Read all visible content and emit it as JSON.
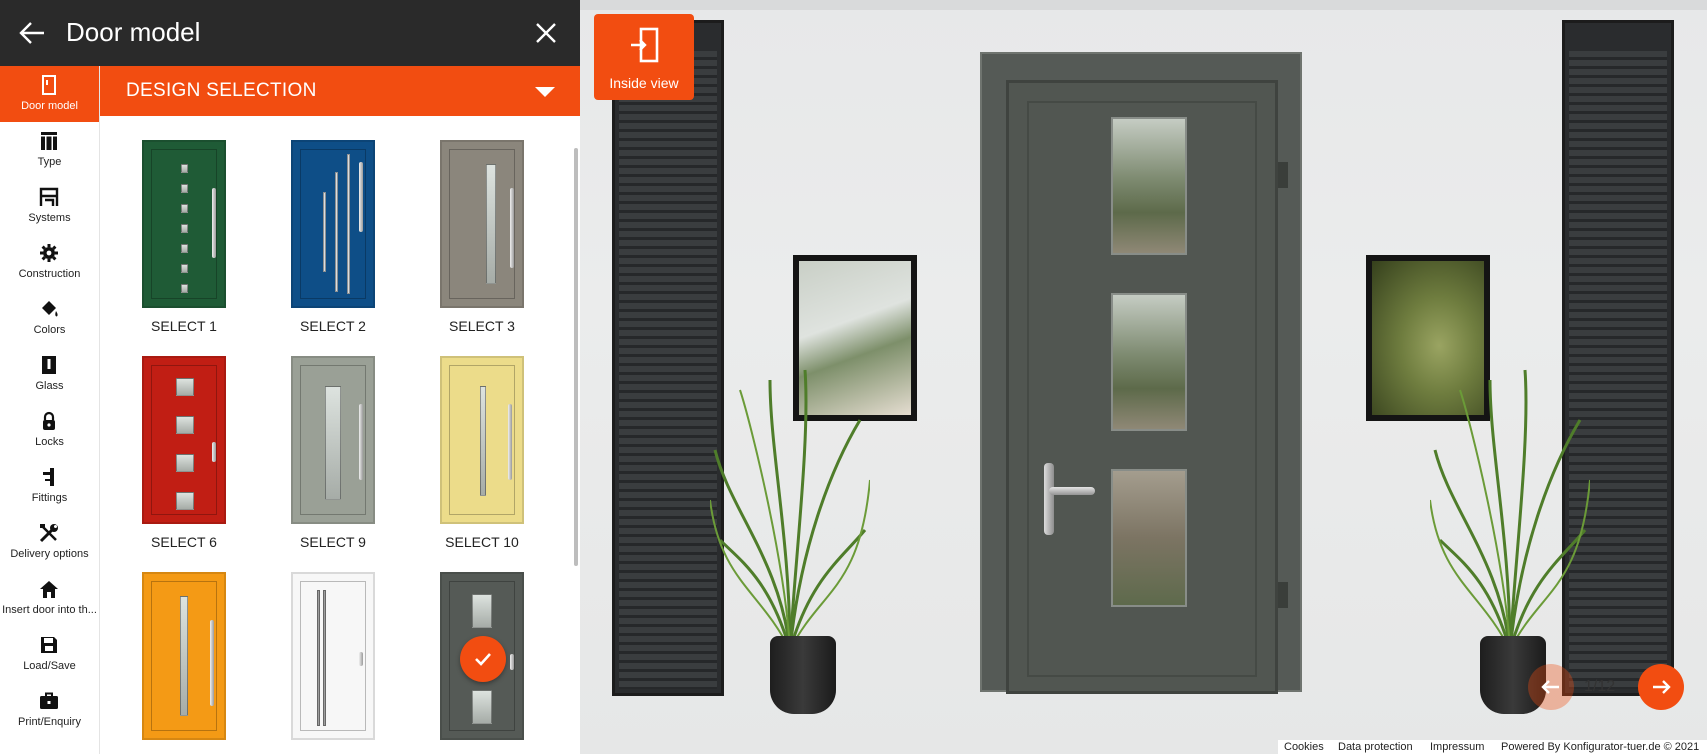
{
  "header": {
    "title": "Door model"
  },
  "nav": {
    "items": [
      {
        "label": "Door model",
        "icon": "door-model-icon"
      },
      {
        "label": "Type",
        "icon": "type-icon"
      },
      {
        "label": "Systems",
        "icon": "systems-icon"
      },
      {
        "label": "Construction",
        "icon": "gear-icon"
      },
      {
        "label": "Colors",
        "icon": "paint-bucket-icon"
      },
      {
        "label": "Glass",
        "icon": "glass-icon"
      },
      {
        "label": "Locks",
        "icon": "lock-icon"
      },
      {
        "label": "Fittings",
        "icon": "fittings-icon"
      },
      {
        "label": "Delivery options",
        "icon": "tools-icon"
      },
      {
        "label": "Insert door into th...",
        "icon": "home-icon"
      },
      {
        "label": "Load/Save",
        "icon": "floppy-disk-icon"
      },
      {
        "label": "Print/Enquiry",
        "icon": "briefcase-icon"
      }
    ]
  },
  "design": {
    "title": "DESIGN SELECTION",
    "doors": [
      {
        "label": "SELECT 1",
        "color": "#1f5b36"
      },
      {
        "label": "SELECT 2",
        "color": "#0e4e87"
      },
      {
        "label": "SELECT 3",
        "color": "#8b867c"
      },
      {
        "label": "SELECT 6",
        "color": "#c11e14"
      },
      {
        "label": "SELECT 9",
        "color": "#9aa096"
      },
      {
        "label": "SELECT 10",
        "color": "#ecdc8a"
      },
      {
        "label": "",
        "color": "#f49a15"
      },
      {
        "label": "",
        "color": "#f7f7f7"
      },
      {
        "label": "",
        "color": "#555a56"
      }
    ]
  },
  "scene": {
    "inside_view_label": "Inside view",
    "pager": "1/12"
  },
  "footer": {
    "cookies": "Cookies",
    "data_protection": "Data protection",
    "impressum": "Impressum",
    "powered_by": "Powered By Konfigurator-tuer.de © 2021"
  },
  "colors": {
    "accent": "#f24d11",
    "topbar": "#2a2a2a",
    "door": "#515651"
  }
}
